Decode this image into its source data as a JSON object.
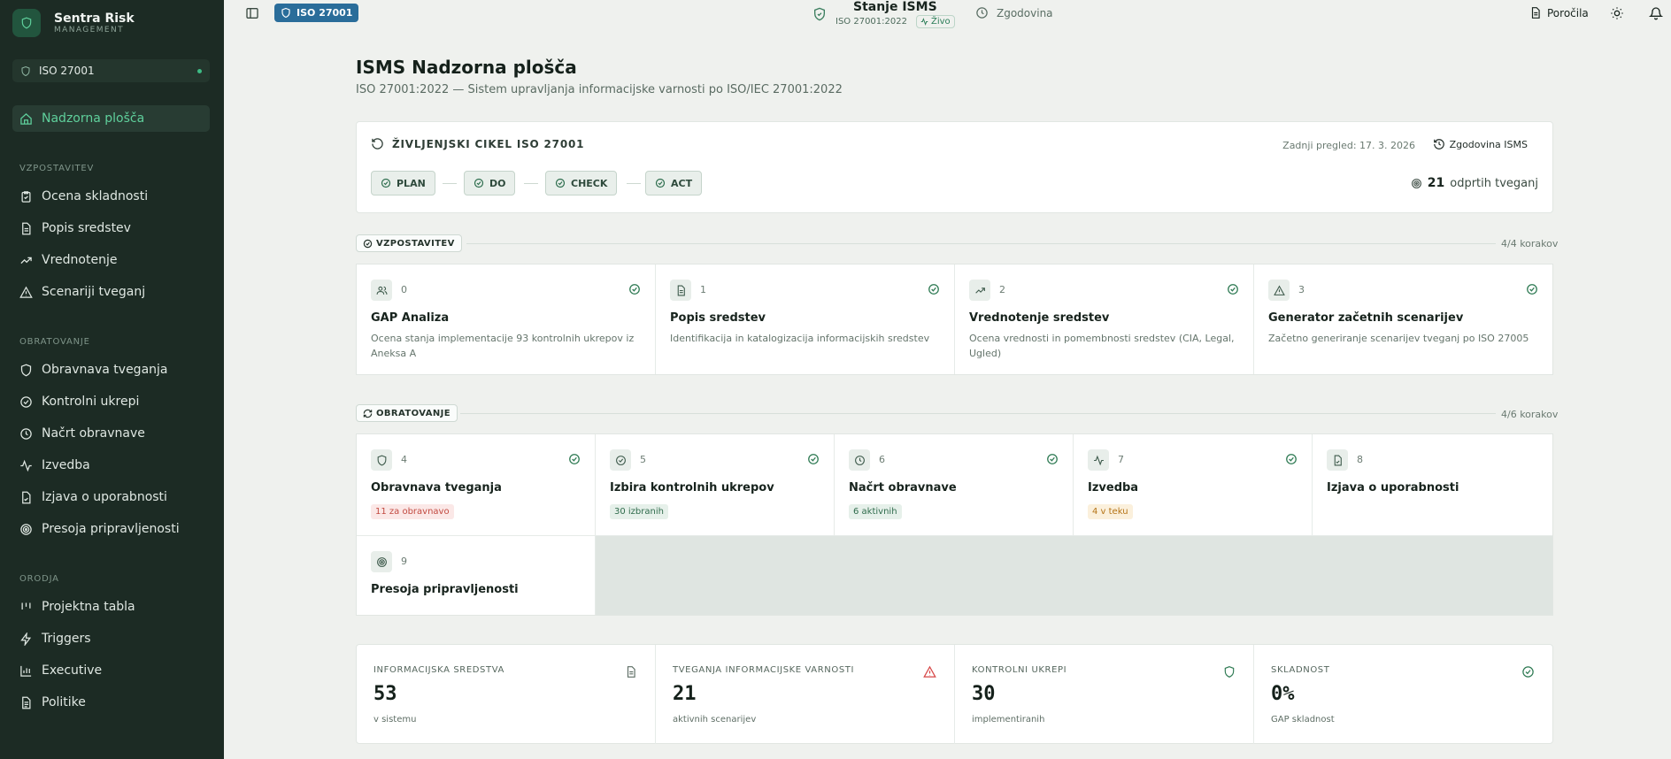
{
  "brand": {
    "name": "Sentra Risk",
    "sub": "MANAGEMENT"
  },
  "workspace": {
    "label": "ISO 27001"
  },
  "sidebar": {
    "active": {
      "label": "Nadzorna plošča",
      "icon": "home-icon"
    },
    "sections": [
      {
        "title": "VZPOSTAVITEV",
        "items": [
          {
            "label": "Ocena skladnosti",
            "icon": "clipboard-check-icon"
          },
          {
            "label": "Popis sredstev",
            "icon": "file-icon"
          },
          {
            "label": "Vrednotenje",
            "icon": "trending-up-icon"
          },
          {
            "label": "Scenariji tveganj",
            "icon": "alert-triangle-icon"
          }
        ]
      },
      {
        "title": "OBRATOVANJE",
        "items": [
          {
            "label": "Obravnava tveganja",
            "icon": "shield-icon"
          },
          {
            "label": "Kontrolni ukrepi",
            "icon": "check-circle-icon"
          },
          {
            "label": "Načrt obravnave",
            "icon": "clock-icon"
          },
          {
            "label": "Izvedba",
            "icon": "activity-icon"
          },
          {
            "label": "Izjava o uporabnosti",
            "icon": "file-check-icon"
          },
          {
            "label": "Presoja pripravljenosti",
            "icon": "target-icon"
          }
        ]
      },
      {
        "title": "ORODJA",
        "items": [
          {
            "label": "Projektna tabla",
            "icon": "kanban-icon"
          },
          {
            "label": "Triggers",
            "icon": "zap-icon"
          },
          {
            "label": "Executive",
            "icon": "bar-chart-icon"
          },
          {
            "label": "Politike",
            "icon": "file-text-icon"
          }
        ]
      }
    ]
  },
  "topbar": {
    "badge": "ISO 27001",
    "status_title": "Stanje ISMS",
    "status_sub": "ISO 27001:2022",
    "live": "Živo",
    "history": "Zgodovina",
    "reports": "Poročila"
  },
  "page": {
    "title": "ISMS Nadzorna plošča",
    "subtitle": "ISO 27001:2022 — Sistem upravljanja informacijske varnosti po ISO/IEC 27001:2022"
  },
  "lifecycle": {
    "title": "ŽIVLJENJSKI CIKEL ISO 27001",
    "last_review": "Zadnji pregled: 17. 3. 2026",
    "history_button": "Zgodovina ISMS",
    "phases": [
      "PLAN",
      "DO",
      "CHECK",
      "ACT"
    ],
    "open_risks_count": "21",
    "open_risks_label": "odprtih tveganj"
  },
  "setup": {
    "label": "VZPOSTAVITEV",
    "count": "4/4 korakov",
    "steps": [
      {
        "num": "0",
        "title": "GAP Analiza",
        "desc": "Ocena stanja implementacije 93 kontrolnih ukrepov iz Aneksa A",
        "icon": "users-icon"
      },
      {
        "num": "1",
        "title": "Popis sredstev",
        "desc": "Identifikacija in katalogizacija informacijskih sredstev",
        "icon": "file-icon"
      },
      {
        "num": "2",
        "title": "Vrednotenje sredstev",
        "desc": "Ocena vrednosti in pomembnosti sredstev (CIA, Legal, Ugled)",
        "icon": "trending-up-icon"
      },
      {
        "num": "3",
        "title": "Generator začetnih scenarijev",
        "desc": "Začetno generiranje scenarijev tveganj po ISO 27005",
        "icon": "alert-triangle-icon"
      }
    ]
  },
  "operation": {
    "label": "OBRATOVANJE",
    "count": "4/6 korakov",
    "steps": [
      {
        "num": "4",
        "title": "Obravnava tveganja",
        "tag": "11 za obravnavo",
        "icon": "shield-icon"
      },
      {
        "num": "5",
        "title": "Izbira kontrolnih ukrepov",
        "tag": "30 izbranih",
        "icon": "check-circle-icon"
      },
      {
        "num": "6",
        "title": "Načrt obravnave",
        "tag": "6 aktivnih",
        "icon": "clock-icon"
      },
      {
        "num": "7",
        "title": "Izvedba",
        "tag": "4 v teku",
        "icon": "activity-icon"
      },
      {
        "num": "8",
        "title": "Izjava o uporabnosti",
        "tag": "",
        "icon": "file-check-icon"
      },
      {
        "num": "9",
        "title": "Presoja pripravljenosti",
        "tag": "",
        "icon": "target-icon"
      }
    ]
  },
  "stats": [
    {
      "label": "INFORMACIJSKA SREDSTVA",
      "value": "53",
      "note": "v sistemu",
      "icon": "file-icon"
    },
    {
      "label": "TVEGANJA INFORMACIJSKE VARNOSTI",
      "value": "21",
      "note": "aktivnih scenarijev",
      "icon": "alert-triangle-icon"
    },
    {
      "label": "KONTROLNI UKREPI",
      "value": "30",
      "note": "implementiranih",
      "icon": "shield-icon"
    },
    {
      "label": "SKLADNOST",
      "value": "0%",
      "note": "GAP skladnost",
      "icon": "check-circle-icon"
    }
  ],
  "colors": {
    "sidebar_bg": "#1c2b24",
    "accent_green": "#5fd09c",
    "badge_blue": "#2a6d9a",
    "danger": "#d64545",
    "warning": "#b57316"
  }
}
